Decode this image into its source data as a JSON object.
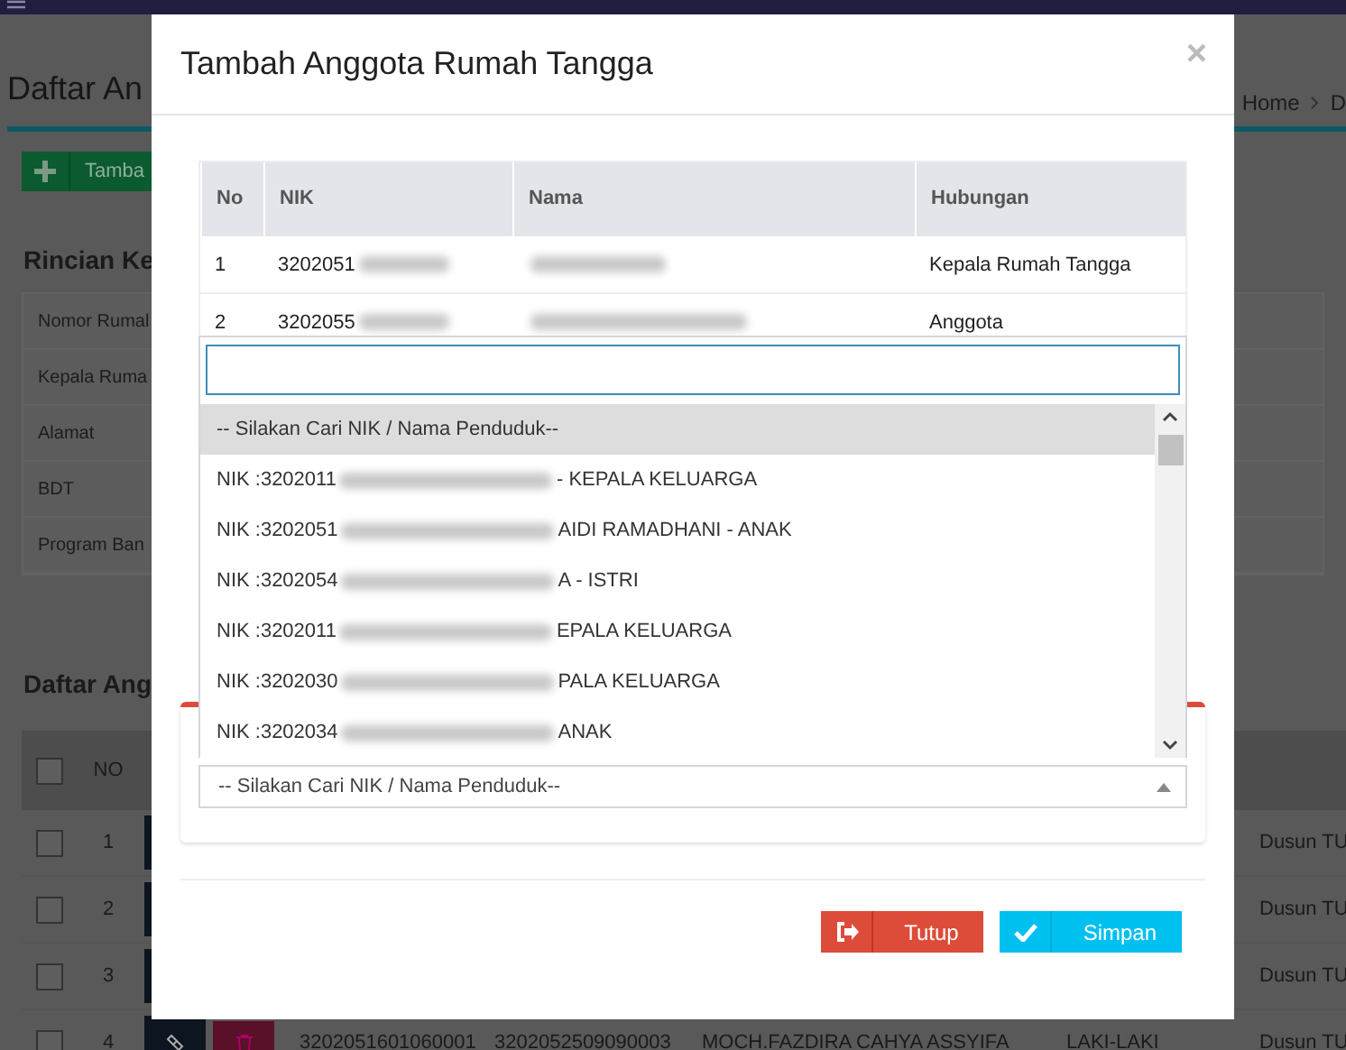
{
  "page": {
    "title": "Daftar An",
    "breadcrumb": [
      "Home",
      "D"
    ],
    "add_button": "Tamba",
    "details_title": "Rincian Ke",
    "details": [
      "Nomor Rumal",
      "Kepala Ruma",
      "Alamat",
      "BDT",
      "Program Ban"
    ],
    "members_title": "Daftar Ang",
    "members_table": {
      "columns": [
        "NO"
      ],
      "select_all_checked": false,
      "rows": [
        {
          "checked": false,
          "no": "1",
          "dusun": "Dusun TU"
        },
        {
          "checked": false,
          "no": "2",
          "dusun": "Dusun TU"
        },
        {
          "checked": false,
          "no": "3",
          "dusun": "Dusun TU"
        },
        {
          "checked": false,
          "no": "4",
          "nik": "3202051601060001",
          "kk": "3202052509090003",
          "nama": "MOCH.FAZDIRA CAHYA ASSYIFA",
          "gender": "LAKI-LAKI",
          "dusun": "Dusun TU"
        }
      ]
    }
  },
  "modal": {
    "title": "Tambah Anggota Rumah Tangga",
    "close": "×",
    "table": {
      "columns": [
        "No",
        "NIK",
        "Nama",
        "Hubungan"
      ],
      "rows": [
        {
          "no": "1",
          "nik": "3202051",
          "nama_redacted": true,
          "hubungan": "Kepala Rumah Tangga"
        },
        {
          "no": "2",
          "nik": "3202055",
          "nama_redacted": true,
          "hubungan": "Anggota"
        }
      ]
    },
    "select": {
      "value": "-- Silakan Cari NIK / Nama Penduduk--",
      "open": true,
      "options": [
        {
          "parts": [
            "-- Silakan Cari NIK / Nama Penduduk--"
          ],
          "selected": true
        },
        {
          "parts": [
            "NIK :3202011",
            "- KEPALA KELUARGA"
          ],
          "selected": false
        },
        {
          "parts": [
            "NIK :3202051",
            "AIDI RAMADHANI - ANAK"
          ],
          "selected": false
        },
        {
          "parts": [
            "NIK :3202054",
            "A - ISTRI"
          ],
          "selected": false
        },
        {
          "parts": [
            "NIK :3202011",
            "EPALA KELUARGA"
          ],
          "selected": false
        },
        {
          "parts": [
            "NIK :3202030",
            "PALA KELUARGA"
          ],
          "selected": false
        },
        {
          "parts": [
            "NIK :3202034",
            "ANAK"
          ],
          "selected": false
        }
      ]
    },
    "buttons": [
      {
        "label": "Tutup",
        "kind": "close"
      },
      {
        "label": "Simpan",
        "kind": "save"
      }
    ]
  }
}
